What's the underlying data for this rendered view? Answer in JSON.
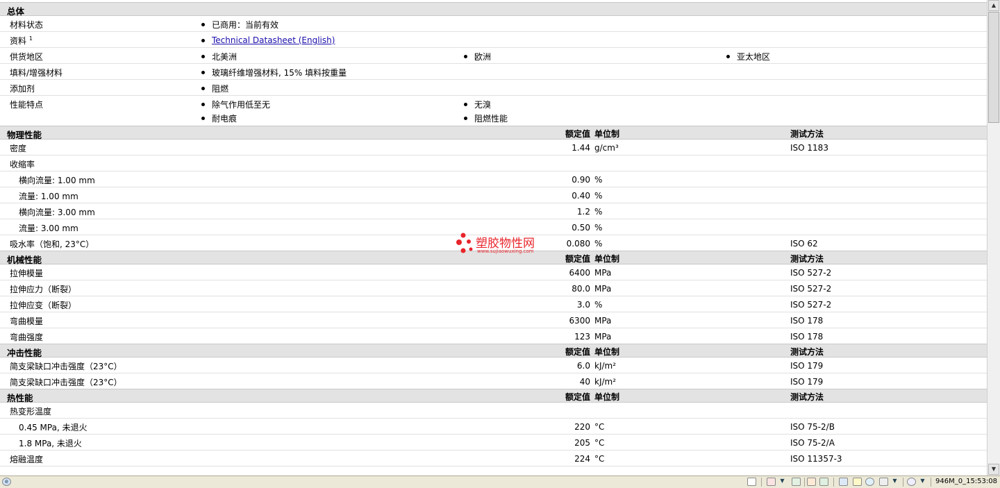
{
  "general": {
    "title": "总体",
    "status_label": "材料状态",
    "status_value": "已商用：当前有效",
    "literature_label": "资料",
    "literature_sup": "1",
    "literature_link": "Technical Datasheet (English)",
    "availability_label": "供货地区",
    "availability": [
      "北美洲",
      "欧洲",
      "亚太地区"
    ],
    "filler_label": "填料/增强材料",
    "filler_value": "玻璃纤维增强材料, 15% 填料按重量",
    "additive_label": "添加剂",
    "additive_value": "阻燃",
    "features_label": "性能特点",
    "features": [
      "除气作用低至无",
      "无溴",
      "耐电痕",
      "阻燃性能"
    ]
  },
  "headers": {
    "value": "额定值",
    "unit": "单位制",
    "method": "测试方法"
  },
  "physical": {
    "title": "物理性能",
    "rows": [
      {
        "label": "密度",
        "value": "1.44",
        "unit": "g/cm³",
        "method": "ISO 1183"
      },
      {
        "label": "收缩率",
        "value": "",
        "unit": "",
        "method": ""
      },
      {
        "label": "横向流量: 1.00 mm",
        "value": "0.90",
        "unit": "%",
        "method": ""
      },
      {
        "label": "流量: 1.00 mm",
        "value": "0.40",
        "unit": "%",
        "method": ""
      },
      {
        "label": "横向流量: 3.00 mm",
        "value": "1.2",
        "unit": "%",
        "method": ""
      },
      {
        "label": "流量: 3.00 mm",
        "value": "0.50",
        "unit": "%",
        "method": ""
      },
      {
        "label": "吸水率（饱和, 23°C）",
        "value": "0.080",
        "unit": "%",
        "method": "ISO 62"
      }
    ]
  },
  "mechanical": {
    "title": "机械性能",
    "rows": [
      {
        "label": "拉伸模量",
        "value": "6400",
        "unit": "MPa",
        "method": "ISO 527-2"
      },
      {
        "label": "拉伸应力（断裂）",
        "value": "80.0",
        "unit": "MPa",
        "method": "ISO 527-2"
      },
      {
        "label": "拉伸应变（断裂）",
        "value": "3.0",
        "unit": "%",
        "method": "ISO 527-2"
      },
      {
        "label": "弯曲模量",
        "value": "6300",
        "unit": "MPa",
        "method": "ISO 178"
      },
      {
        "label": "弯曲强度",
        "value": "123",
        "unit": "MPa",
        "method": "ISO 178"
      }
    ]
  },
  "impact": {
    "title": "冲击性能",
    "rows": [
      {
        "label": "简支梁缺口冲击强度（23°C）",
        "value": "6.0",
        "unit": "kJ/m²",
        "method": "ISO 179"
      },
      {
        "label": "简支梁缺口冲击强度（23°C）",
        "value": "40",
        "unit": "kJ/m²",
        "method": "ISO 179"
      }
    ]
  },
  "thermal": {
    "title": "热性能",
    "rows": [
      {
        "label": "热变形温度",
        "value": "",
        "unit": "",
        "method": ""
      },
      {
        "label": "0.45 MPa, 未退火",
        "value": "220",
        "unit": "°C",
        "method": "ISO 75-2/B"
      },
      {
        "label": "1.8 MPa, 未退火",
        "value": "205",
        "unit": "°C",
        "method": "ISO 75-2/A"
      },
      {
        "label": "熔融温度",
        "value": "224",
        "unit": "°C",
        "method": "ISO 11357-3"
      }
    ]
  },
  "watermark": {
    "name": "塑胶物性网",
    "url": "www.sujiaowuxing.com"
  },
  "statusbar": {
    "text": "946M_0_15:53:08"
  }
}
